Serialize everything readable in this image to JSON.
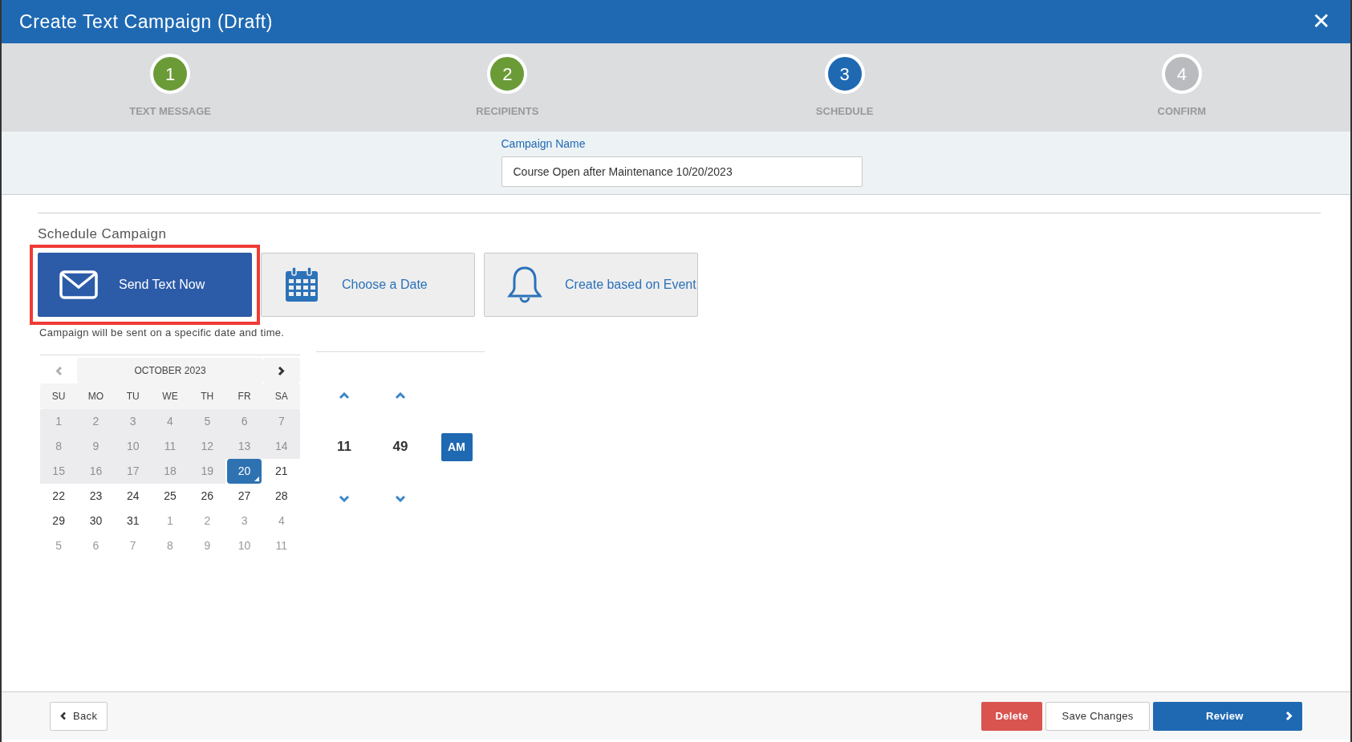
{
  "window": {
    "title": "Create Text Campaign (Draft)",
    "close": "✕"
  },
  "steps": [
    {
      "number": "1",
      "label": "TEXT MESSAGE",
      "completed": true,
      "selected": false
    },
    {
      "number": "2",
      "label": "RECIPIENTS",
      "completed": true,
      "selected": false
    },
    {
      "number": "3",
      "label": "SCHEDULE",
      "completed": false,
      "selected": true
    },
    {
      "number": "4",
      "label": "CONFIRM",
      "completed": false,
      "selected": false
    }
  ],
  "campaign_name": {
    "label": "Campaign Name",
    "value": "Course Open after Maintenance 10/20/2023"
  },
  "schedule": {
    "title": "Schedule Campaign",
    "options": [
      {
        "kind": "envelope",
        "label": "Send Text Now",
        "selected": true,
        "highlighted": true
      },
      {
        "kind": "calendar",
        "label": "Choose a Date",
        "selected": false,
        "highlighted": false
      },
      {
        "kind": "bell",
        "label": "Create based on Event",
        "selected": false,
        "highlighted": false
      }
    ],
    "description": "Campaign will be sent on a specific date and time."
  },
  "calendar": {
    "month": "OCTOBER 2023",
    "prev_disabled": true,
    "weekdays": [
      "SU",
      "MO",
      "TU",
      "WE",
      "TH",
      "FR",
      "SA"
    ],
    "days": [
      {
        "label": "1",
        "kind": "past",
        "selected": false
      },
      {
        "label": "2",
        "kind": "past",
        "selected": false
      },
      {
        "label": "3",
        "kind": "past",
        "selected": false
      },
      {
        "label": "4",
        "kind": "past",
        "selected": false
      },
      {
        "label": "5",
        "kind": "past",
        "selected": false
      },
      {
        "label": "6",
        "kind": "past",
        "selected": false
      },
      {
        "label": "7",
        "kind": "past",
        "selected": false
      },
      {
        "label": "8",
        "kind": "past",
        "selected": false
      },
      {
        "label": "9",
        "kind": "past",
        "selected": false
      },
      {
        "label": "10",
        "kind": "past",
        "selected": false
      },
      {
        "label": "11",
        "kind": "past",
        "selected": false
      },
      {
        "label": "12",
        "kind": "past",
        "selected": false
      },
      {
        "label": "13",
        "kind": "past",
        "selected": false
      },
      {
        "label": "14",
        "kind": "past",
        "selected": false
      },
      {
        "label": "15",
        "kind": "past",
        "selected": false
      },
      {
        "label": "16",
        "kind": "past",
        "selected": false
      },
      {
        "label": "17",
        "kind": "past",
        "selected": false
      },
      {
        "label": "18",
        "kind": "past",
        "selected": false
      },
      {
        "label": "19",
        "kind": "past",
        "selected": false
      },
      {
        "label": "20",
        "kind": "current",
        "selected": true
      },
      {
        "label": "21",
        "kind": "current",
        "selected": false
      },
      {
        "label": "22",
        "kind": "current",
        "selected": false
      },
      {
        "label": "23",
        "kind": "current",
        "selected": false
      },
      {
        "label": "24",
        "kind": "current",
        "selected": false
      },
      {
        "label": "25",
        "kind": "current",
        "selected": false
      },
      {
        "label": "26",
        "kind": "current",
        "selected": false
      },
      {
        "label": "27",
        "kind": "current",
        "selected": false
      },
      {
        "label": "28",
        "kind": "current",
        "selected": false
      },
      {
        "label": "29",
        "kind": "current",
        "selected": false
      },
      {
        "label": "30",
        "kind": "current",
        "selected": false
      },
      {
        "label": "31",
        "kind": "current",
        "selected": false
      },
      {
        "label": "1",
        "kind": "other",
        "selected": false
      },
      {
        "label": "2",
        "kind": "other",
        "selected": false
      },
      {
        "label": "3",
        "kind": "other",
        "selected": false
      },
      {
        "label": "4",
        "kind": "other",
        "selected": false
      },
      {
        "label": "5",
        "kind": "other",
        "selected": false
      },
      {
        "label": "6",
        "kind": "other",
        "selected": false
      },
      {
        "label": "7",
        "kind": "other",
        "selected": false
      },
      {
        "label": "8",
        "kind": "other",
        "selected": false
      },
      {
        "label": "9",
        "kind": "other",
        "selected": false
      },
      {
        "label": "10",
        "kind": "other",
        "selected": false
      },
      {
        "label": "11",
        "kind": "other",
        "selected": false
      }
    ]
  },
  "time": {
    "hour": "11",
    "minute": "49",
    "period": "AM"
  },
  "footer": {
    "back": "Back",
    "delete": "Delete",
    "save": "Save Changes",
    "review": "Review"
  }
}
